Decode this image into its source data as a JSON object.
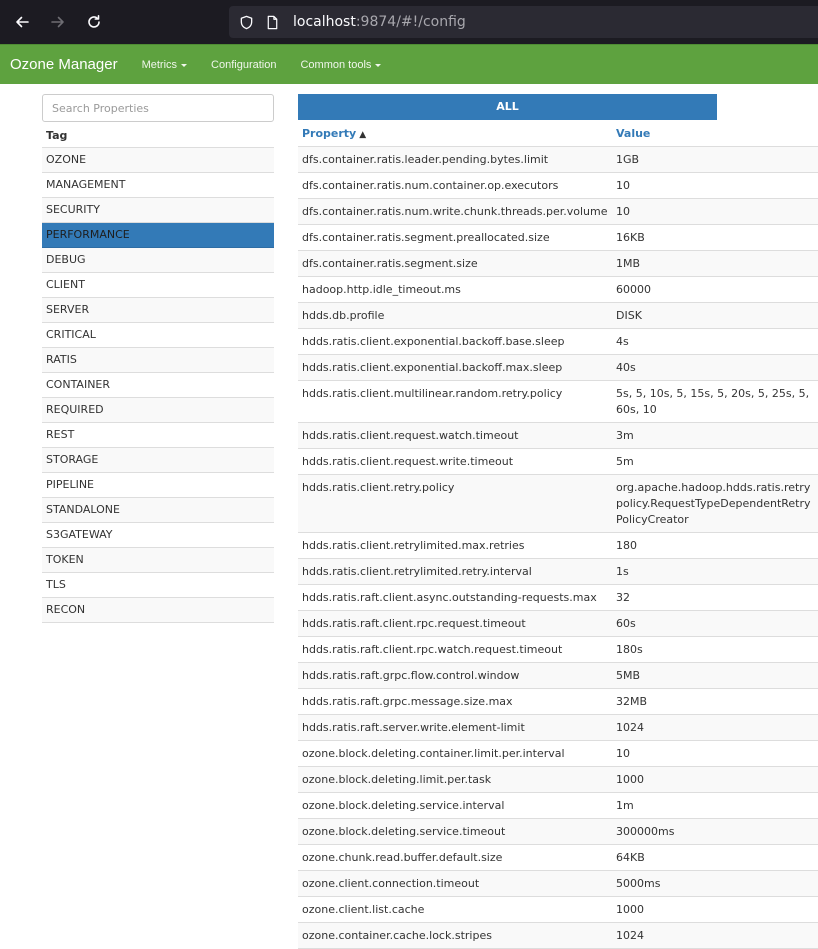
{
  "browser": {
    "url_host": "localhost",
    "url_rest": ":9874/#!/config"
  },
  "navbar": {
    "brand": "Ozone Manager",
    "links": [
      "Metrics",
      "Configuration",
      "Common tools"
    ]
  },
  "sidebar": {
    "search_placeholder": "Search Properties",
    "tag_header": "Tag",
    "tags": [
      "OZONE",
      "MANAGEMENT",
      "SECURITY",
      "PERFORMANCE",
      "DEBUG",
      "CLIENT",
      "SERVER",
      "CRITICAL",
      "RATIS",
      "CONTAINER",
      "REQUIRED",
      "REST",
      "STORAGE",
      "PIPELINE",
      "STANDALONE",
      "S3GATEWAY",
      "TOKEN",
      "TLS",
      "RECON"
    ],
    "active_tag": "PERFORMANCE"
  },
  "main": {
    "all_button": "ALL",
    "col_property": "Property",
    "sort_indicator": "▲",
    "col_value": "Value",
    "rows": [
      [
        "dfs.container.ratis.leader.pending.bytes.limit",
        "1GB"
      ],
      [
        "dfs.container.ratis.num.container.op.executors",
        "10"
      ],
      [
        "dfs.container.ratis.num.write.chunk.threads.per.volume",
        "10"
      ],
      [
        "dfs.container.ratis.segment.preallocated.size",
        "16KB"
      ],
      [
        "dfs.container.ratis.segment.size",
        "1MB"
      ],
      [
        "hadoop.http.idle_timeout.ms",
        "60000"
      ],
      [
        "hdds.db.profile",
        "DISK"
      ],
      [
        "hdds.ratis.client.exponential.backoff.base.sleep",
        "4s"
      ],
      [
        "hdds.ratis.client.exponential.backoff.max.sleep",
        "40s"
      ],
      [
        "hdds.ratis.client.multilinear.random.retry.policy",
        "5s, 5, 10s, 5, 15s, 5, 20s, 5, 25s, 5, 60s, 10"
      ],
      [
        "hdds.ratis.client.request.watch.timeout",
        "3m"
      ],
      [
        "hdds.ratis.client.request.write.timeout",
        "5m"
      ],
      [
        "hdds.ratis.client.retry.policy",
        "org.apache.hadoop.hdds.ratis.retrypolicy.RequestTypeDependentRetryPolicyCreator"
      ],
      [
        "hdds.ratis.client.retrylimited.max.retries",
        "180"
      ],
      [
        "hdds.ratis.client.retrylimited.retry.interval",
        "1s"
      ],
      [
        "hdds.ratis.raft.client.async.outstanding-requests.max",
        "32"
      ],
      [
        "hdds.ratis.raft.client.rpc.request.timeout",
        "60s"
      ],
      [
        "hdds.ratis.raft.client.rpc.watch.request.timeout",
        "180s"
      ],
      [
        "hdds.ratis.raft.grpc.flow.control.window",
        "5MB"
      ],
      [
        "hdds.ratis.raft.grpc.message.size.max",
        "32MB"
      ],
      [
        "hdds.ratis.raft.server.write.element-limit",
        "1024"
      ],
      [
        "ozone.block.deleting.container.limit.per.interval",
        "10"
      ],
      [
        "ozone.block.deleting.limit.per.task",
        "1000"
      ],
      [
        "ozone.block.deleting.service.interval",
        "1m"
      ],
      [
        "ozone.block.deleting.service.timeout",
        "300000ms"
      ],
      [
        "ozone.chunk.read.buffer.default.size",
        "64KB"
      ],
      [
        "ozone.client.connection.timeout",
        "5000ms"
      ],
      [
        "ozone.client.list.cache",
        "1000"
      ],
      [
        "ozone.container.cache.lock.stripes",
        "1024"
      ]
    ]
  }
}
